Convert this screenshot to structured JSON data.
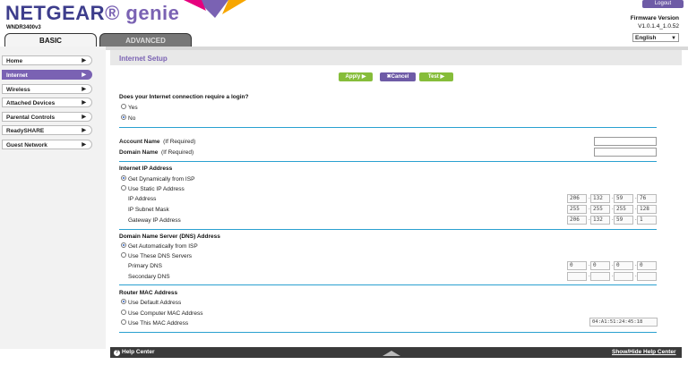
{
  "header": {
    "brand": "NETGEAR",
    "brand_suffix": "genie",
    "model": "WNDR3400v3",
    "logout_label": "Logout",
    "firmware_label": "Firmware Version",
    "firmware_value": "V1.0.1.4_1.0.52",
    "language": "English"
  },
  "tabs": {
    "basic": "BASIC",
    "advanced": "ADVANCED"
  },
  "menu": {
    "items": [
      {
        "label": "Home"
      },
      {
        "label": "Internet"
      },
      {
        "label": "Wireless"
      },
      {
        "label": "Attached Devices"
      },
      {
        "label": "Parental Controls"
      },
      {
        "label": "ReadySHARE"
      },
      {
        "label": "Guest Network"
      }
    ]
  },
  "page": {
    "title": "Internet Setup",
    "apply": "Apply",
    "cancel": "Cancel",
    "test": "Test",
    "login_question": "Does your Internet connection require a login?",
    "login_yes": "Yes",
    "login_no": "No",
    "account_name": "Account Name",
    "account_hint": "(If Required)",
    "domain_name": "Domain Name",
    "domain_hint": "(If Required)",
    "ip_section": "Internet IP Address",
    "ip_dynamic": "Get Dynamically from ISP",
    "ip_static": "Use Static IP Address",
    "ip_address_label": "IP Address",
    "subnet_label": "IP Subnet Mask",
    "gateway_label": "Gateway IP Address",
    "ip_address": [
      "206",
      "132",
      "59",
      "76"
    ],
    "subnet": [
      "255",
      "255",
      "255",
      "128"
    ],
    "gateway": [
      "206",
      "132",
      "59",
      "1"
    ],
    "dns_section": "Domain Name Server (DNS) Address",
    "dns_auto": "Get Automatically from ISP",
    "dns_manual": "Use These DNS Servers",
    "primary_dns_label": "Primary DNS",
    "secondary_dns_label": "Secondary DNS",
    "primary_dns": [
      "0",
      "0",
      "0",
      "0"
    ],
    "secondary_dns": [
      "",
      "",
      "",
      ""
    ],
    "mac_section": "Router MAC Address",
    "mac_default": "Use Default Address",
    "mac_computer": "Use Computer MAC Address",
    "mac_this": "Use This MAC Address",
    "mac_value": "04:A1:51:24:45:18"
  },
  "footer": {
    "help_center": "Help Center",
    "toggle_help": "Show/Hide Help Center"
  },
  "colors": {
    "accent": "#7a62b3",
    "green": "#86bd3a",
    "separator": "#2aa0d0"
  }
}
